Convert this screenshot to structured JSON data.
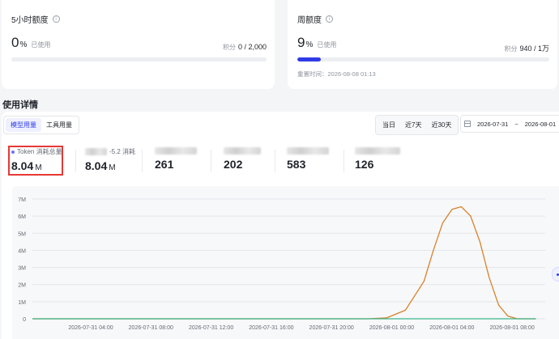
{
  "quota_5h": {
    "title": "5小时额度",
    "percent": "0",
    "percent_unit": "%",
    "used_label": "已使用",
    "points_label": "积分",
    "points_value": "0 / 2,000",
    "progress": 0
  },
  "quota_week": {
    "title": "周额度",
    "percent": "9",
    "percent_unit": "%",
    "used_label": "已使用",
    "points_label": "积分",
    "points_value": "940 / 1万",
    "progress": 0.094,
    "reset_label": "重置时间：2026-08-08 01:13"
  },
  "usage": {
    "section_title": "使用详情",
    "tabs": [
      {
        "label": "模型用量",
        "active": true
      },
      {
        "label": "工具用量",
        "active": false
      }
    ],
    "ranges": [
      "当日",
      "近7天",
      "近30天"
    ],
    "date_start": "2026-07-31",
    "date_sep": "~",
    "date_end": "2026-08-01",
    "stats": [
      {
        "label": "Token 消耗总量",
        "value": "8.04",
        "unit": "M",
        "highlight": true
      },
      {
        "label": "-5.2 消耗",
        "value": "8.04",
        "unit": "M"
      },
      {
        "value": "261"
      },
      {
        "value": "202"
      },
      {
        "value": "583"
      },
      {
        "value": "126"
      }
    ]
  },
  "chart_data": {
    "type": "line",
    "y_ticks": [
      "7M",
      "6M",
      "5M",
      "4M",
      "3M",
      "2M",
      "1M",
      "0"
    ],
    "ylim": [
      0,
      7
    ],
    "y_unit": "M",
    "x_ticks": [
      "2026-07-31 04:00",
      "2026-07-31 08:00",
      "2026-07-31 12:00",
      "2026-07-31 16:00",
      "2026-07-31 20:00",
      "2026-08-01 00:00",
      "2026-08-01 04:00",
      "2026-08-01 08:00"
    ],
    "grid": true,
    "series": [
      {
        "color": "#d9822b",
        "points": [
          [
            0,
            0
          ],
          [
            18,
            0
          ],
          [
            19,
            0.05
          ],
          [
            20,
            0.5
          ],
          [
            21,
            2.2
          ],
          [
            21.5,
            4.0
          ],
          [
            22,
            5.6
          ],
          [
            22.5,
            6.4
          ],
          [
            23,
            6.55
          ],
          [
            23.5,
            6.0
          ],
          [
            24,
            4.5
          ],
          [
            24.5,
            2.4
          ],
          [
            25,
            0.8
          ],
          [
            25.5,
            0.15
          ],
          [
            26,
            0
          ],
          [
            27,
            0
          ]
        ]
      },
      {
        "color": "#3bb58a",
        "points": [
          [
            0,
            0
          ],
          [
            27,
            0
          ]
        ]
      }
    ],
    "x_range": [
      0,
      27.5
    ]
  }
}
